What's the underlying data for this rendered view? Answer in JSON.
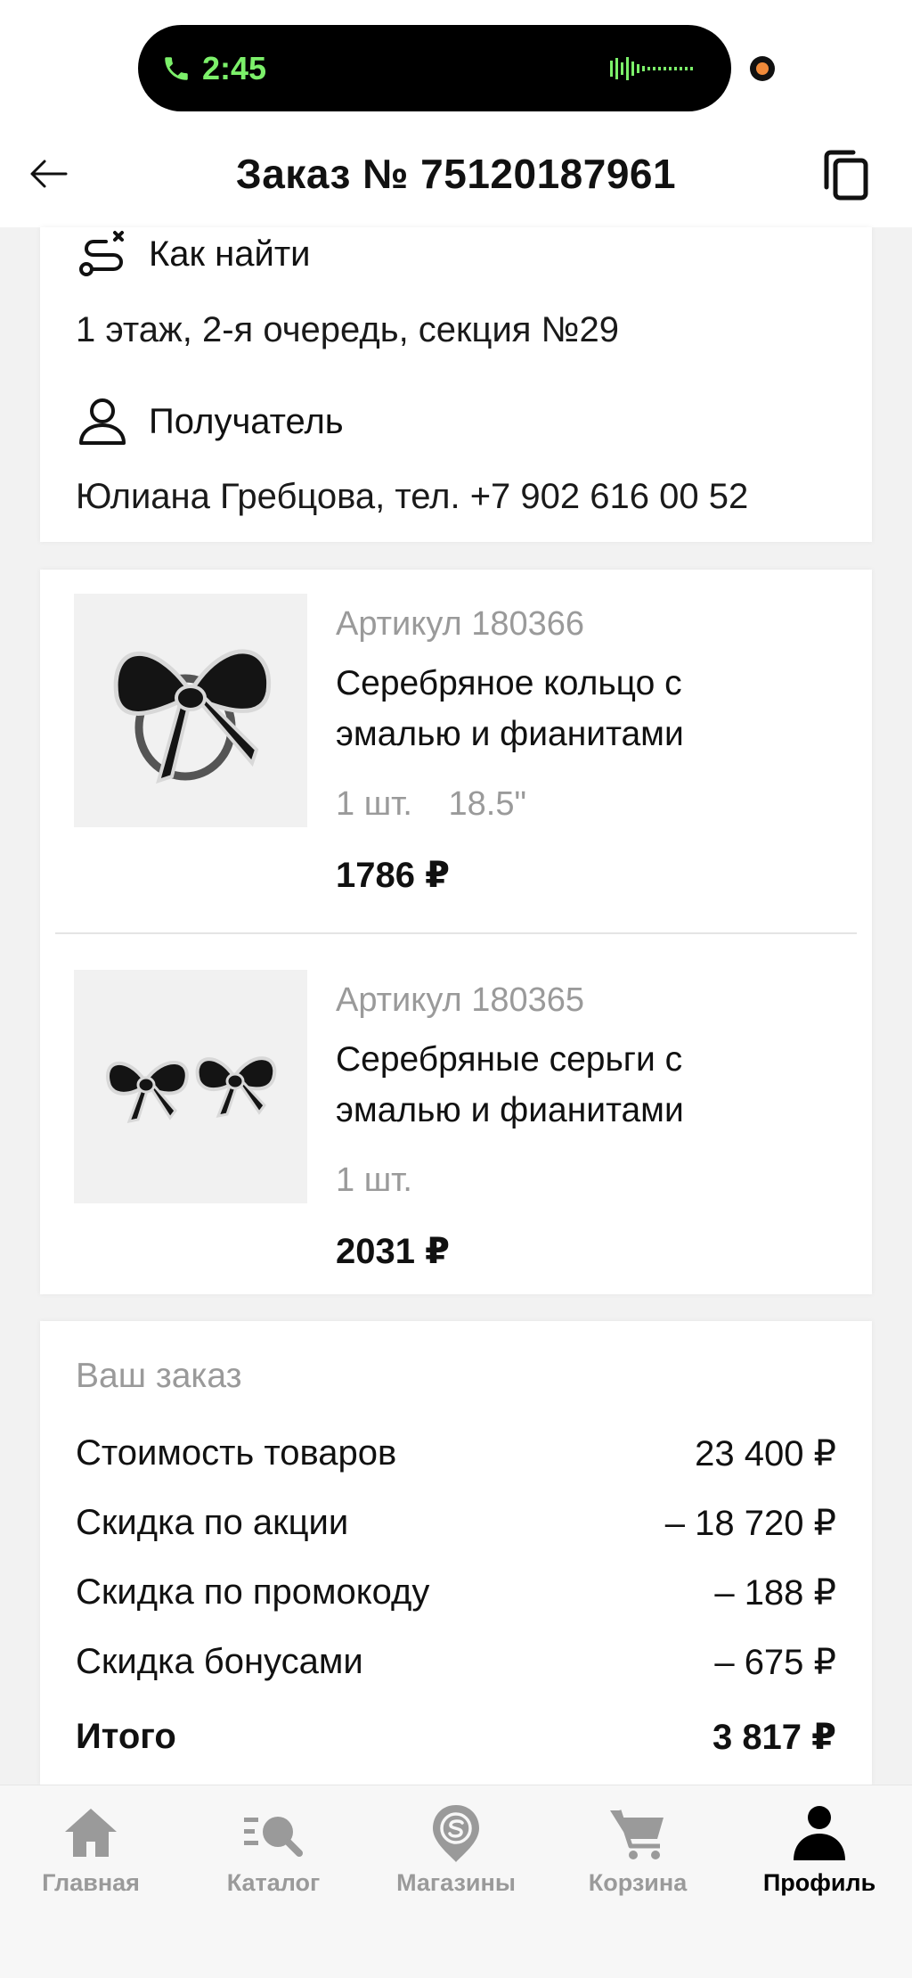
{
  "status_bar": {
    "time": "2:45"
  },
  "header": {
    "title": "Заказ № 75120187961"
  },
  "pickup": {
    "how_to_find_label": "Как найти",
    "how_to_find_text": "1 этаж, 2-я очередь, секция №29",
    "recipient_label": "Получатель",
    "recipient_text": "Юлиана Гребцова, тел. +7 902 616 00 52"
  },
  "items": [
    {
      "article": "Артикул 180366",
      "name_line1": "Серебряное кольцо с",
      "name_line2": "эмалью и фианитами",
      "qty": "1 шт.",
      "size": "18.5\"",
      "price": "1786 ₽"
    },
    {
      "article": "Артикул 180365",
      "name_line1": "Серебряные серьги с",
      "name_line2": "эмалью и фианитами",
      "qty": "1 шт.",
      "price": "2031 ₽"
    }
  ],
  "summary": {
    "title": "Ваш заказ",
    "rows": [
      {
        "label": "Стоимость товаров",
        "value": "23 400 ₽"
      },
      {
        "label": "Скидка по акции",
        "value": "– 18 720 ₽"
      },
      {
        "label": "Скидка по промокоду",
        "value": "– 188 ₽"
      },
      {
        "label": "Скидка бонусами",
        "value": "– 675 ₽"
      }
    ],
    "total_label": "Итого",
    "total_value": "3 817 ₽"
  },
  "tabbar": {
    "items": [
      {
        "label": "Главная",
        "icon": "home-icon"
      },
      {
        "label": "Каталог",
        "icon": "catalog-search-icon"
      },
      {
        "label": "Магазины",
        "icon": "store-pin-icon"
      },
      {
        "label": "Корзина",
        "icon": "cart-icon"
      },
      {
        "label": "Профиль",
        "icon": "profile-icon"
      }
    ],
    "active_index": 4
  },
  "colors": {
    "accent_call": "#7cf06a",
    "muted": "#9a9a9a",
    "camera_dot": "#f08a3a"
  }
}
